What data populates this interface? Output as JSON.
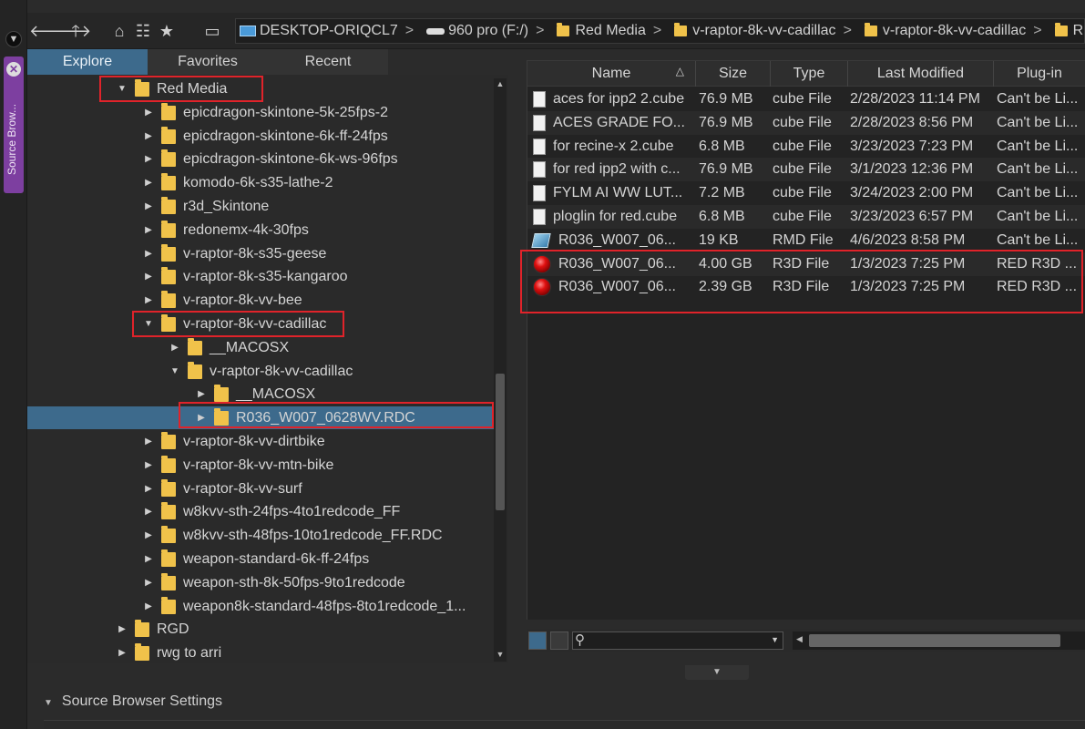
{
  "toolbar": {
    "icons": [
      "back-arrow-icon",
      "forward-arrow-icon",
      "up-arrow-icon",
      "home-icon",
      "folder-tree-icon",
      "favorite-star-icon",
      "drive-icon"
    ]
  },
  "breadcrumb": [
    {
      "label": "DESKTOP-ORIQCL7",
      "icon": "computer-icon"
    },
    {
      "label": "960 pro (F:/)",
      "icon": "drive-icon"
    },
    {
      "label": "Red Media",
      "icon": "folder-icon"
    },
    {
      "label": "v-raptor-8k-vv-cadillac",
      "icon": "folder-icon"
    },
    {
      "label": "v-raptor-8k-vv-cadillac",
      "icon": "folder-icon"
    },
    {
      "label": "R",
      "icon": "folder-icon"
    }
  ],
  "side_tab": {
    "label": "Source Brow..."
  },
  "tabs": [
    {
      "label": "Explore",
      "active": true
    },
    {
      "label": "Favorites",
      "active": false
    },
    {
      "label": "Recent",
      "active": false
    }
  ],
  "tree": [
    {
      "label": "Red Media",
      "level": 0,
      "expanded": true
    },
    {
      "label": "epicdragon-skintone-5k-25fps-2",
      "level": 1,
      "expanded": false
    },
    {
      "label": "epicdragon-skintone-6k-ff-24fps",
      "level": 1,
      "expanded": false
    },
    {
      "label": "epicdragon-skintone-6k-ws-96fps",
      "level": 1,
      "expanded": false
    },
    {
      "label": "komodo-6k-s35-lathe-2",
      "level": 1,
      "expanded": false
    },
    {
      "label": "r3d_Skintone",
      "level": 1,
      "expanded": false
    },
    {
      "label": "redonemx-4k-30fps",
      "level": 1,
      "expanded": false
    },
    {
      "label": "v-raptor-8k-s35-geese",
      "level": 1,
      "expanded": false
    },
    {
      "label": "v-raptor-8k-s35-kangaroo",
      "level": 1,
      "expanded": false
    },
    {
      "label": "v-raptor-8k-vv-bee",
      "level": 1,
      "expanded": false
    },
    {
      "label": "v-raptor-8k-vv-cadillac",
      "level": 1,
      "expanded": true
    },
    {
      "label": "__MACOSX",
      "level": 2,
      "expanded": false
    },
    {
      "label": "v-raptor-8k-vv-cadillac",
      "level": 2,
      "expanded": true
    },
    {
      "label": "__MACOSX",
      "level": 3,
      "expanded": false
    },
    {
      "label": "R036_W007_0628WV.RDC",
      "level": 3,
      "expanded": false,
      "selected": true
    },
    {
      "label": "v-raptor-8k-vv-dirtbike",
      "level": 1,
      "expanded": false
    },
    {
      "label": "v-raptor-8k-vv-mtn-bike",
      "level": 1,
      "expanded": false
    },
    {
      "label": "v-raptor-8k-vv-surf",
      "level": 1,
      "expanded": false
    },
    {
      "label": "w8kvv-sth-24fps-4to1redcode_FF",
      "level": 1,
      "expanded": false
    },
    {
      "label": "w8kvv-sth-48fps-10to1redcode_FF.RDC",
      "level": 1,
      "expanded": false
    },
    {
      "label": "weapon-standard-6k-ff-24fps",
      "level": 1,
      "expanded": false
    },
    {
      "label": "weapon-sth-8k-50fps-9to1redcode",
      "level": 1,
      "expanded": false
    },
    {
      "label": "weapon8k-standard-48fps-8to1redcode_1...",
      "level": 1,
      "expanded": false
    },
    {
      "label": "RGD",
      "level": 0,
      "expanded": false
    },
    {
      "label": "rwg to arri",
      "level": 0,
      "expanded": false
    }
  ],
  "list": {
    "columns": [
      "Name",
      "Size",
      "Type",
      "Last Modified",
      "Plug-in"
    ],
    "sort_indicator": "△",
    "rows": [
      {
        "name": "aces for ipp2 2.cube",
        "size": "76.9 MB",
        "type": "cube File",
        "modified": "2/28/2023 11:14 PM",
        "plugin": "Can't be Li...",
        "icon": "document-icon"
      },
      {
        "name": "ACES GRADE FO...",
        "size": "76.9 MB",
        "type": "cube File",
        "modified": "2/28/2023 8:56 PM",
        "plugin": "Can't be Li...",
        "icon": "document-icon"
      },
      {
        "name": "for recine-x 2.cube",
        "size": "6.8 MB",
        "type": "cube File",
        "modified": "3/23/2023 7:23 PM",
        "plugin": "Can't be Li...",
        "icon": "document-icon"
      },
      {
        "name": "for red ipp2 with c...",
        "size": "76.9 MB",
        "type": "cube File",
        "modified": "3/1/2023 12:36 PM",
        "plugin": "Can't be Li...",
        "icon": "document-icon"
      },
      {
        "name": "FYLM AI WW LUT...",
        "size": "7.2 MB",
        "type": "cube File",
        "modified": "3/24/2023 2:00 PM",
        "plugin": "Can't be Li...",
        "icon": "document-icon"
      },
      {
        "name": "ploglin for red.cube",
        "size": "6.8 MB",
        "type": "cube File",
        "modified": "3/23/2023 6:57 PM",
        "plugin": "Can't be Li...",
        "icon": "document-icon"
      },
      {
        "name": "R036_W007_06...",
        "size": "19 KB",
        "type": "RMD File",
        "modified": "4/6/2023 8:58 PM",
        "plugin": "Can't be Li...",
        "icon": "rmd-file-icon"
      },
      {
        "name": "R036_W007_06...",
        "size": "4.00 GB",
        "type": "R3D File",
        "modified": "1/3/2023 7:25 PM",
        "plugin": "RED R3D ...",
        "icon": "r3d-file-icon"
      },
      {
        "name": "R036_W007_06...",
        "size": "2.39 GB",
        "type": "R3D File",
        "modified": "1/3/2023 7:25 PM",
        "plugin": "RED R3D ...",
        "icon": "r3d-file-icon"
      }
    ]
  },
  "settings": {
    "label": "Source Browser Settings"
  }
}
